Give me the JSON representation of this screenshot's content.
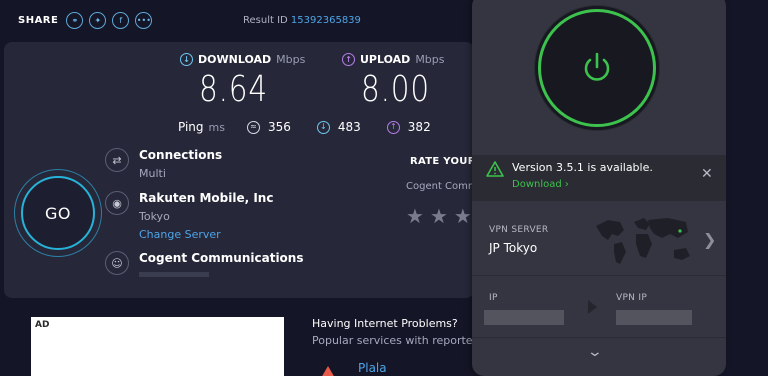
{
  "share": {
    "label": "SHARE",
    "icons": [
      "link-icon",
      "twitter-icon",
      "facebook-icon",
      "more-icon"
    ]
  },
  "result": {
    "label": "Result ID",
    "id": "15392365839"
  },
  "download": {
    "label": "DOWNLOAD",
    "unit": "Mbps",
    "value": "8.64"
  },
  "upload": {
    "label": "UPLOAD",
    "unit": "Mbps",
    "value": "8.00"
  },
  "ping": {
    "label": "Ping",
    "unit": "ms",
    "jitter": "356",
    "down": "483",
    "up": "382"
  },
  "connections": {
    "title": "Connections",
    "mode": "Multi"
  },
  "isp": {
    "name": "Rakuten Mobile, Inc",
    "location": "Tokyo",
    "change_label": "Change Server"
  },
  "server": {
    "name": "Cogent Communications",
    "sub": "-"
  },
  "go_label": "GO",
  "rate": {
    "title": "RATE YOUR I",
    "sub": "Cogent Comm",
    "stars": 3
  },
  "ad": {
    "label": "AD"
  },
  "problems": {
    "title": "Having Internet Problems?",
    "sub": "Popular services with reported",
    "service": "Plala"
  },
  "vpn": {
    "notice": "Version 3.5.1 is available.",
    "notice_link": "Download ›",
    "server_label": "VPN SERVER",
    "server_value": "JP Tokyo",
    "ip_label": "IP",
    "vpn_ip_label": "VPN IP",
    "accent": "#3dc24e"
  }
}
